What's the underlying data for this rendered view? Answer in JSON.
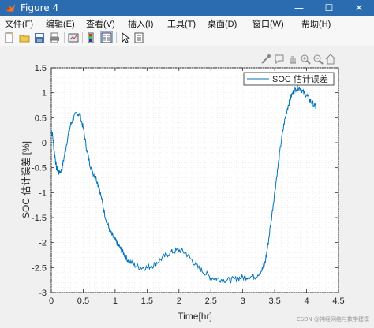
{
  "window": {
    "title": "Figure 4",
    "minimize_glyph": "—",
    "maximize_glyph": "☐",
    "close_glyph": "✕"
  },
  "menubar": {
    "items": [
      "文件(F)",
      "编辑(E)",
      "查看(V)",
      "插入(I)",
      "工具(T)",
      "桌面(D)",
      "窗口(W)",
      "帮助(H)"
    ]
  },
  "toolbar": {
    "buttons": [
      "new-figure-icon",
      "open-file-icon",
      "save-icon",
      "print-icon",
      "link-plot-icon",
      "insert-colorbar-icon",
      "insert-legend-icon",
      "edit-plot-icon",
      "property-inspector-icon"
    ]
  },
  "axes_toolbar": {
    "buttons": [
      "brush-icon",
      "data-tip-icon",
      "pan-icon",
      "zoom-in-icon",
      "zoom-out-icon",
      "home-icon"
    ]
  },
  "colors": {
    "titlebar": "#2b6cb0",
    "line": "#0072bd",
    "grid": "#d9d9d9",
    "axes_bg": "#ffffff"
  },
  "chart_data": {
    "type": "line",
    "title": "",
    "xlabel": "Time[hr]",
    "ylabel": "SOC 估计误差 [%]",
    "xlim": [
      0,
      4.5
    ],
    "ylim": [
      -3,
      1.5
    ],
    "xticks": [
      "0",
      "0.5",
      "1",
      "1.5",
      "2",
      "2.5",
      "3",
      "3.5",
      "4",
      "4.5"
    ],
    "yticks": [
      "1.5",
      "1",
      "0.5",
      "0",
      "-0.5",
      "-1",
      "-1.5",
      "-2",
      "-2.5",
      "-3"
    ],
    "grid": "minor",
    "legend_position": "top-right",
    "series": [
      {
        "name": "SOC 估计误差",
        "color": "#0072bd",
        "x": [
          0,
          0.02,
          0.05,
          0.08,
          0.12,
          0.16,
          0.2,
          0.25,
          0.3,
          0.35,
          0.4,
          0.45,
          0.5,
          0.55,
          0.6,
          0.65,
          0.7,
          0.75,
          0.8,
          0.85,
          0.9,
          0.95,
          1.0,
          1.05,
          1.1,
          1.15,
          1.2,
          1.3,
          1.4,
          1.5,
          1.6,
          1.7,
          1.8,
          1.9,
          2.0,
          2.1,
          2.2,
          2.3,
          2.4,
          2.5,
          2.6,
          2.7,
          2.8,
          2.9,
          3.0,
          3.1,
          3.2,
          3.3,
          3.35,
          3.4,
          3.45,
          3.5,
          3.55,
          3.6,
          3.65,
          3.7,
          3.75,
          3.8,
          3.85,
          3.9,
          3.95,
          4.0,
          4.05,
          4.1,
          4.15
        ],
        "y": [
          0.25,
          0.15,
          -0.2,
          -0.5,
          -0.6,
          -0.55,
          -0.3,
          0.05,
          0.35,
          0.5,
          0.6,
          0.55,
          0.3,
          -0.1,
          -0.4,
          -0.6,
          -0.7,
          -0.9,
          -1.2,
          -1.5,
          -1.7,
          -1.85,
          -1.95,
          -2.05,
          -2.15,
          -2.25,
          -2.35,
          -2.45,
          -2.5,
          -2.5,
          -2.45,
          -2.35,
          -2.25,
          -2.18,
          -2.15,
          -2.2,
          -2.35,
          -2.5,
          -2.6,
          -2.7,
          -2.72,
          -2.75,
          -2.75,
          -2.72,
          -2.7,
          -2.68,
          -2.68,
          -2.55,
          -2.4,
          -2.0,
          -1.5,
          -1.0,
          -0.5,
          0.0,
          0.4,
          0.7,
          0.9,
          1.05,
          1.1,
          1.1,
          1.0,
          0.95,
          0.85,
          0.78,
          0.7
        ]
      }
    ]
  },
  "watermark": "CSDN @神经网络与数学建模"
}
